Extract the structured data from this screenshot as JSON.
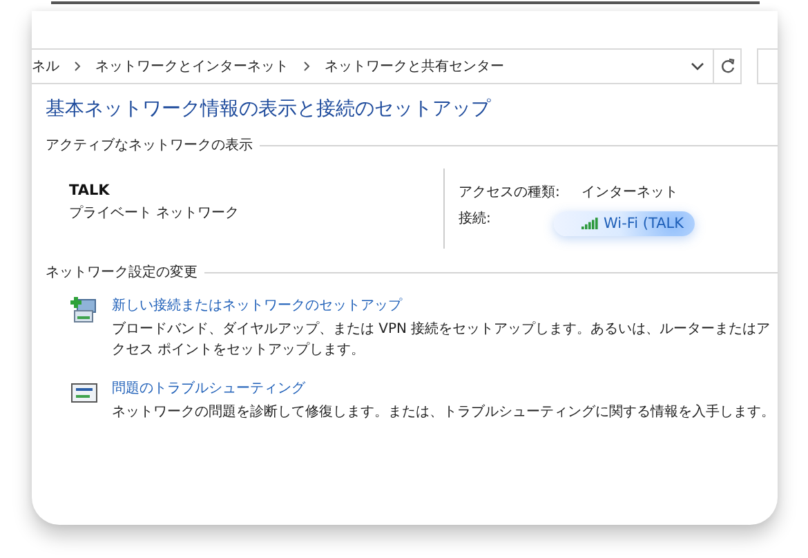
{
  "address_bar": {
    "crumbs": [
      "ネル",
      "ネットワークとインターネット",
      "ネットワークと共有センター"
    ]
  },
  "title": "基本ネットワーク情報の表示と接続のセットアップ",
  "active_networks": {
    "heading": "アクティブなネットワークの表示",
    "name": "TALK",
    "type": "プライベート ネットワーク",
    "access_label": "アクセスの種類:",
    "access_value": "インターネット",
    "connection_label": "接続:",
    "connection_value": "Wi-Fi (TALK",
    "highlighted": true
  },
  "settings": {
    "heading": "ネットワーク設定の変更",
    "tasks": [
      {
        "kind": "new-connection",
        "link": "新しい接続またはネットワークのセットアップ",
        "description": "ブロードバンド、ダイヤルアップ、または VPN 接続をセットアップします。あるいは、ルーターまたはアクセス ポイントをセットアップします。"
      },
      {
        "kind": "troubleshoot",
        "link": "問題のトラブルシューティング",
        "description": "ネットワークの問題を診断して修復します。または、トラブルシューティングに関する情報を入手します。"
      }
    ]
  }
}
